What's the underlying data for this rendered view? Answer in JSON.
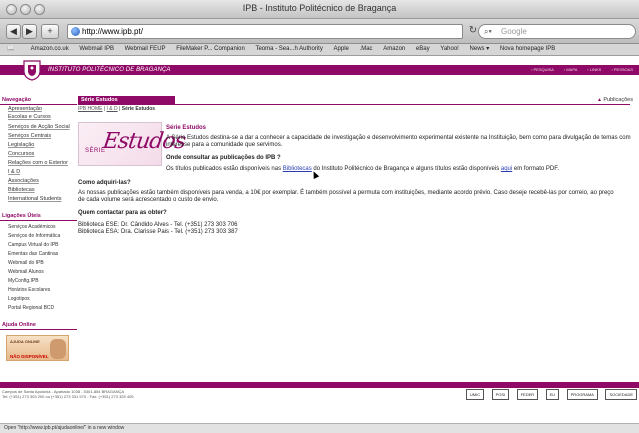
{
  "window": {
    "title": "IPB - Instituto Politécnico de Bragança"
  },
  "toolbar": {
    "back": "◀",
    "forward": "▶",
    "add": "+",
    "url": "http://www.ipb.pt/",
    "reload": "↻",
    "search_placeholder": "Google"
  },
  "bookmarks": [
    "Amazon.co.uk",
    "Webmail IPB",
    "Webmail FEUP",
    "FileMaker P... Companion",
    "Teoma - Sea...h Authority",
    "Apple",
    ".Mac",
    "Amazon",
    "eBay",
    "Yahoo!",
    "News ▾",
    "Nova homepage IPB"
  ],
  "header": {
    "institution": "INSTITUTO POLITÉCNICO DE BRAGANÇA",
    "links": [
      "PESQUISA",
      "MAPA",
      "LINKS",
      "PESSOAS"
    ]
  },
  "sidebar": {
    "nav_title": "Navegação",
    "nav_items": [
      "Apresentação",
      "Escolas e Cursos",
      "Serviços de Acção Social",
      "Serviços Centrais",
      "Legislação",
      "Concursos",
      "Relações com o Exterior",
      "I & D",
      "Associações",
      "Bibliotecas",
      "International Students"
    ],
    "links_title": "Ligações Úteis",
    "links_items": [
      "Serviços Académicos",
      "Serviços de Informática",
      "Campus Virtual do IPB",
      "Ementas das Cantinas",
      "Webmail do IPB",
      "Webmail Alunos",
      "MyConfig.IPB",
      "Horários Escolares",
      "Logotipos",
      "Portal Regional BCD"
    ],
    "ajuda_title": "Ajuda Online",
    "ajuda_box_title": "AJUDA ONLINE",
    "ajuda_box_status": "NÃO DISPONÍVEL"
  },
  "content": {
    "tab_title": "Série Estudos",
    "breadcrumb_home": "IPB HOME",
    "breadcrumb_mid": "I & D",
    "breadcrumb_current": "Série Estudos",
    "publications_link": "Publicações",
    "banner_serie": "SÉRIE",
    "banner_estudos": "Estudos",
    "intro_head": "Série Estudos",
    "intro_text": "A Série Estudos destina-se a dar a conhecer a capacidade de investigação e desenvolvimento experimental existente na Instituição, bem como para divulgação de temas com interesse para a comunidade que servimos.",
    "q1_title": "Onde consultar as publicações do IPB ?",
    "q1_pre": "Os títulos publicados estão disponíveis nas ",
    "q1_link1": "Bibliotecas",
    "q1_mid": " do Instituto Politécnico de Bragança e alguns títulos estão disponíveis ",
    "q1_link2": "aqui",
    "q1_post": " em formato PDF.",
    "q2_title": "Como adquiri-las?",
    "q2_text": "As nossas publicações estão também disponíveis para venda, a 10€ por exemplar. É também possível a permuta com instituições, mediante acordo prévio. Caso deseje recebê-las por correio, ao preço de cada volume será acrescentado o custo de envio.",
    "q3_title": "Quem contactar para as obter?",
    "contact1": "Biblioteca ESE: Dr. Cândido Alves - Tel. (+351) 273 303 706",
    "contact2": "Biblioteca ESA: Dra. Clarisse Pais - Tel. (+351) 273 303 387"
  },
  "footer": {
    "address1": "Campus de Santa Apolónia - Apartado 1038 - 5301-854 BRAGANÇA",
    "address2": "Tel: (+351) 273 303 200 ou (+351) 273 331 570 - Fax: (+351) 273 325 405",
    "logos": [
      "UMIC",
      "POSI",
      "FEDER",
      "EU",
      "PROGRAMA",
      "SOCIEDADE"
    ]
  },
  "status": {
    "text": "Open \"http://www.ipb.pt/ajudaonline/\" in a new window"
  },
  "colors": {
    "brand": "#8e0a66"
  }
}
